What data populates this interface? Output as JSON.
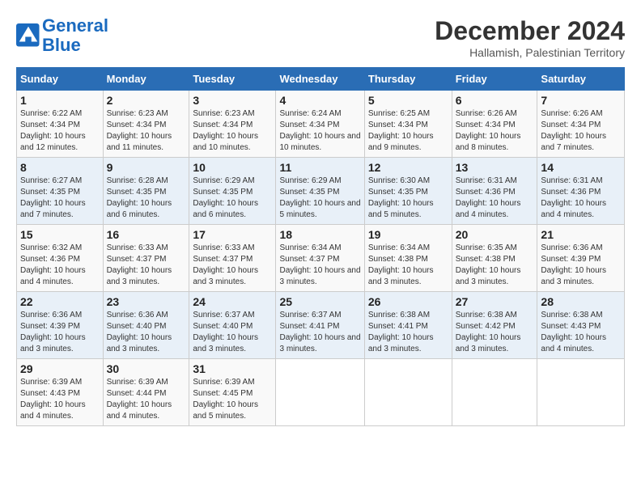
{
  "header": {
    "logo_line1": "General",
    "logo_line2": "Blue",
    "title": "December 2024",
    "subtitle": "Hallamish, Palestinian Territory"
  },
  "days_of_week": [
    "Sunday",
    "Monday",
    "Tuesday",
    "Wednesday",
    "Thursday",
    "Friday",
    "Saturday"
  ],
  "weeks": [
    [
      {
        "day": "1",
        "sunrise": "6:22 AM",
        "sunset": "4:34 PM",
        "daylight": "10 hours and 12 minutes."
      },
      {
        "day": "2",
        "sunrise": "6:23 AM",
        "sunset": "4:34 PM",
        "daylight": "10 hours and 11 minutes."
      },
      {
        "day": "3",
        "sunrise": "6:23 AM",
        "sunset": "4:34 PM",
        "daylight": "10 hours and 10 minutes."
      },
      {
        "day": "4",
        "sunrise": "6:24 AM",
        "sunset": "4:34 PM",
        "daylight": "10 hours and 10 minutes."
      },
      {
        "day": "5",
        "sunrise": "6:25 AM",
        "sunset": "4:34 PM",
        "daylight": "10 hours and 9 minutes."
      },
      {
        "day": "6",
        "sunrise": "6:26 AM",
        "sunset": "4:34 PM",
        "daylight": "10 hours and 8 minutes."
      },
      {
        "day": "7",
        "sunrise": "6:26 AM",
        "sunset": "4:34 PM",
        "daylight": "10 hours and 7 minutes."
      }
    ],
    [
      {
        "day": "8",
        "sunrise": "6:27 AM",
        "sunset": "4:35 PM",
        "daylight": "10 hours and 7 minutes."
      },
      {
        "day": "9",
        "sunrise": "6:28 AM",
        "sunset": "4:35 PM",
        "daylight": "10 hours and 6 minutes."
      },
      {
        "day": "10",
        "sunrise": "6:29 AM",
        "sunset": "4:35 PM",
        "daylight": "10 hours and 6 minutes."
      },
      {
        "day": "11",
        "sunrise": "6:29 AM",
        "sunset": "4:35 PM",
        "daylight": "10 hours and 5 minutes."
      },
      {
        "day": "12",
        "sunrise": "6:30 AM",
        "sunset": "4:35 PM",
        "daylight": "10 hours and 5 minutes."
      },
      {
        "day": "13",
        "sunrise": "6:31 AM",
        "sunset": "4:36 PM",
        "daylight": "10 hours and 4 minutes."
      },
      {
        "day": "14",
        "sunrise": "6:31 AM",
        "sunset": "4:36 PM",
        "daylight": "10 hours and 4 minutes."
      }
    ],
    [
      {
        "day": "15",
        "sunrise": "6:32 AM",
        "sunset": "4:36 PM",
        "daylight": "10 hours and 4 minutes."
      },
      {
        "day": "16",
        "sunrise": "6:33 AM",
        "sunset": "4:37 PM",
        "daylight": "10 hours and 3 minutes."
      },
      {
        "day": "17",
        "sunrise": "6:33 AM",
        "sunset": "4:37 PM",
        "daylight": "10 hours and 3 minutes."
      },
      {
        "day": "18",
        "sunrise": "6:34 AM",
        "sunset": "4:37 PM",
        "daylight": "10 hours and 3 minutes."
      },
      {
        "day": "19",
        "sunrise": "6:34 AM",
        "sunset": "4:38 PM",
        "daylight": "10 hours and 3 minutes."
      },
      {
        "day": "20",
        "sunrise": "6:35 AM",
        "sunset": "4:38 PM",
        "daylight": "10 hours and 3 minutes."
      },
      {
        "day": "21",
        "sunrise": "6:36 AM",
        "sunset": "4:39 PM",
        "daylight": "10 hours and 3 minutes."
      }
    ],
    [
      {
        "day": "22",
        "sunrise": "6:36 AM",
        "sunset": "4:39 PM",
        "daylight": "10 hours and 3 minutes."
      },
      {
        "day": "23",
        "sunrise": "6:36 AM",
        "sunset": "4:40 PM",
        "daylight": "10 hours and 3 minutes."
      },
      {
        "day": "24",
        "sunrise": "6:37 AM",
        "sunset": "4:40 PM",
        "daylight": "10 hours and 3 minutes."
      },
      {
        "day": "25",
        "sunrise": "6:37 AM",
        "sunset": "4:41 PM",
        "daylight": "10 hours and 3 minutes."
      },
      {
        "day": "26",
        "sunrise": "6:38 AM",
        "sunset": "4:41 PM",
        "daylight": "10 hours and 3 minutes."
      },
      {
        "day": "27",
        "sunrise": "6:38 AM",
        "sunset": "4:42 PM",
        "daylight": "10 hours and 3 minutes."
      },
      {
        "day": "28",
        "sunrise": "6:38 AM",
        "sunset": "4:43 PM",
        "daylight": "10 hours and 4 minutes."
      }
    ],
    [
      {
        "day": "29",
        "sunrise": "6:39 AM",
        "sunset": "4:43 PM",
        "daylight": "10 hours and 4 minutes."
      },
      {
        "day": "30",
        "sunrise": "6:39 AM",
        "sunset": "4:44 PM",
        "daylight": "10 hours and 4 minutes."
      },
      {
        "day": "31",
        "sunrise": "6:39 AM",
        "sunset": "4:45 PM",
        "daylight": "10 hours and 5 minutes."
      },
      null,
      null,
      null,
      null
    ]
  ]
}
